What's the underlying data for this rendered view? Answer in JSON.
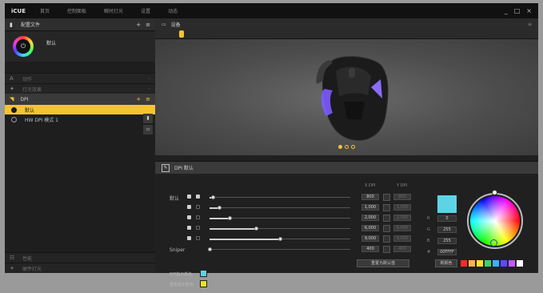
{
  "titlebar": {
    "app_name": "iCUE",
    "nav": [
      "首页",
      "控制面板",
      "瞬时灯光",
      "设置",
      "动态"
    ],
    "controls": [
      "_",
      "□",
      "×"
    ]
  },
  "profiles": {
    "header": "配置文件",
    "add": "+",
    "menu": "≡",
    "current_name": "默认"
  },
  "sections": {
    "actions": "动作",
    "lighting": "灯光效果",
    "dpi": "DPI",
    "performance": "性能",
    "hardware_lighting": "硬件灯光"
  },
  "dpi_list": [
    {
      "label": "默认",
      "selected": true
    },
    {
      "label": "HW DPI 模式 1",
      "selected": false
    }
  ],
  "device": {
    "header": "设备",
    "menu_icon": "≡"
  },
  "dpi_panel": {
    "header": "DPI  默认",
    "col_x": "X DPI",
    "col_y": "Y DPI",
    "default_label": "默认",
    "sniper_label": "Sniper",
    "rows": [
      {
        "x": "800",
        "y": "800",
        "fill": 0.02
      },
      {
        "x": "1,000",
        "y": "1,000",
        "fill": 0.07
      },
      {
        "x": "2,000",
        "y": "2,000",
        "fill": 0.14
      },
      {
        "x": "6,000",
        "y": "6,000",
        "fill": 0.33
      },
      {
        "x": "9,000",
        "y": "9,000",
        "fill": 0.5
      },
      {
        "x": "400",
        "y": "400",
        "fill": 0.0
      }
    ],
    "reset_label": "重置为默认值",
    "indicator_label": "DPI指示颜色",
    "sniper_color_label": "狙击指示颜色"
  },
  "color": {
    "current_hex": "#5fd3e6",
    "r_label": "R",
    "g_label": "G",
    "b_label": "B",
    "hex_label": "#",
    "r": "0",
    "g": "255",
    "b": "255",
    "hex": "00FFFF",
    "apply_label": "新颜色",
    "presets": [
      "#ff2a2a",
      "#ffb347",
      "#ffe135",
      "#3fd36b",
      "#3ab0ff",
      "#5b4bff",
      "#c25bff",
      "#ffffff"
    ],
    "dpi_indicator": "#5fd3e6",
    "sniper_indicator": "#e8e22a"
  }
}
